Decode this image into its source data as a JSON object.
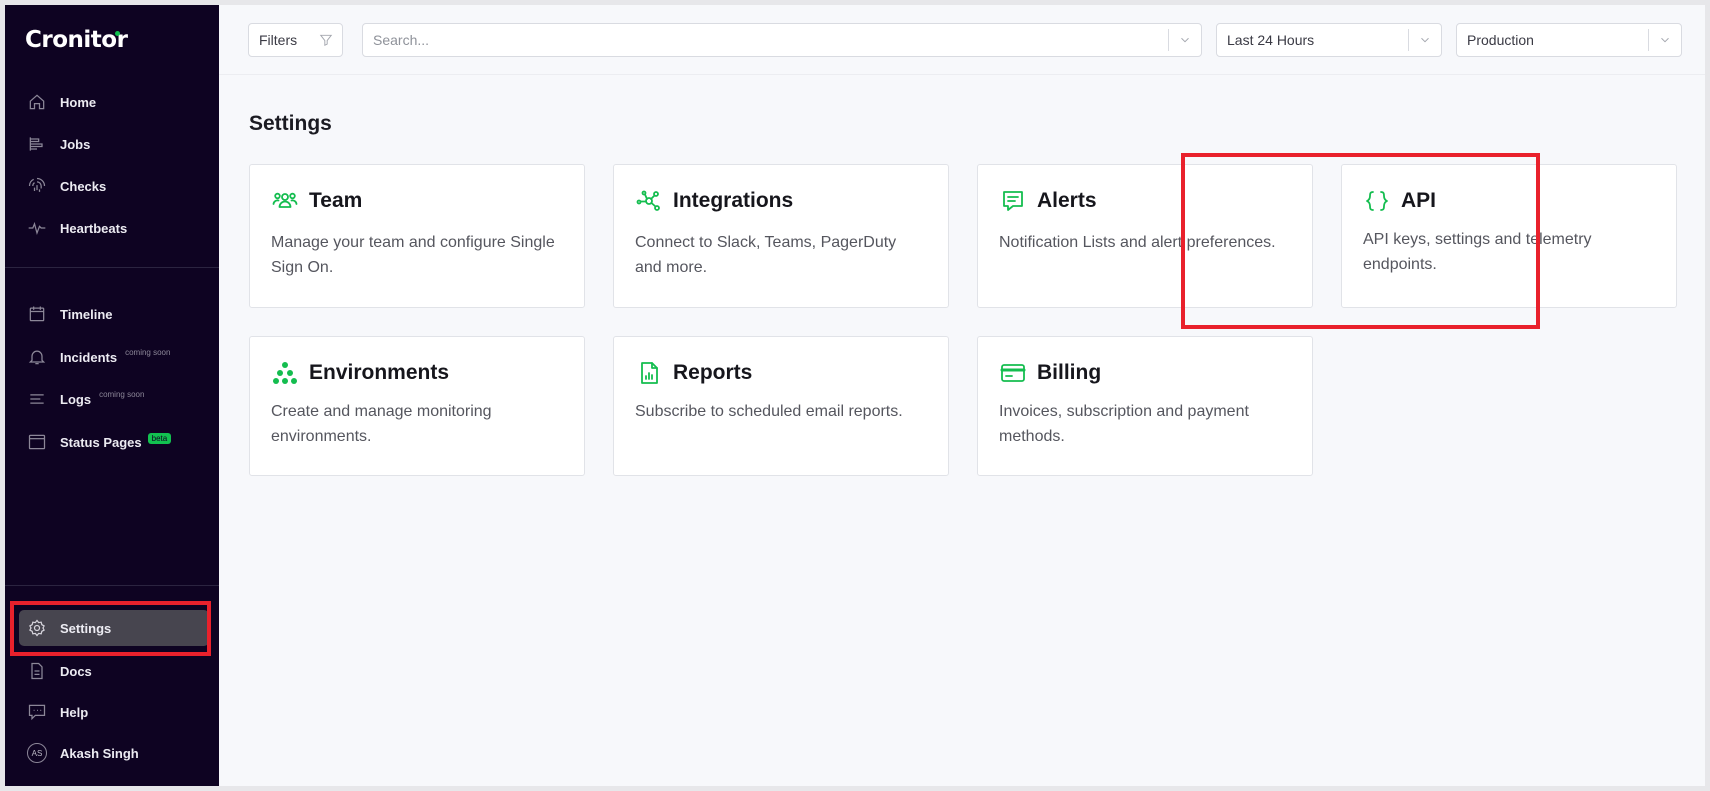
{
  "app": {
    "brand": "Cronitor"
  },
  "sidebar": {
    "primary": [
      {
        "label": "Home",
        "icon": "home-icon"
      },
      {
        "label": "Jobs",
        "icon": "jobs-icon"
      },
      {
        "label": "Checks",
        "icon": "fingerprint-icon"
      },
      {
        "label": "Heartbeats",
        "icon": "pulse-icon"
      }
    ],
    "secondary": [
      {
        "label": "Timeline",
        "icon": "calendar-icon"
      },
      {
        "label": "Incidents",
        "icon": "bell-icon",
        "tag": "coming soon"
      },
      {
        "label": "Logs",
        "icon": "list-icon",
        "tag": "coming soon"
      },
      {
        "label": "Status Pages",
        "icon": "window-icon",
        "badge": "beta"
      }
    ],
    "bottom": [
      {
        "label": "Settings",
        "icon": "gear-icon",
        "active": true
      },
      {
        "label": "Docs",
        "icon": "document-icon"
      },
      {
        "label": "Help",
        "icon": "chat-icon"
      },
      {
        "label": "Akash Singh",
        "icon": "avatar",
        "initials": "AS"
      }
    ]
  },
  "topbar": {
    "filters_label": "Filters",
    "search_placeholder": "Search...",
    "time_range": "Last 24 Hours",
    "environment": "Production"
  },
  "page": {
    "title": "Settings"
  },
  "cards": [
    {
      "title": "Team",
      "icon": "team-icon",
      "desc": "Manage your team and configure Single Sign On."
    },
    {
      "title": "Integrations",
      "icon": "integrations-icon",
      "desc": "Connect to Slack, Teams, PagerDuty and more."
    },
    {
      "title": "Alerts",
      "icon": "alert-message-icon",
      "desc": "Notification Lists and alert preferences."
    },
    {
      "title": "API",
      "icon": "braces-icon",
      "desc": "API keys, settings and telemetry endpoints."
    },
    {
      "title": "Environments",
      "icon": "environments-icon",
      "desc": "Create and manage monitoring environments."
    },
    {
      "title": "Reports",
      "icon": "report-icon",
      "desc": "Subscribe to scheduled email reports."
    },
    {
      "title": "Billing",
      "icon": "credit-card-icon",
      "desc": "Invoices, subscription and payment methods."
    }
  ],
  "colors": {
    "sidebar_bg": "#0e0322",
    "accent": "#14bd4f",
    "highlight": "#e9212c"
  }
}
